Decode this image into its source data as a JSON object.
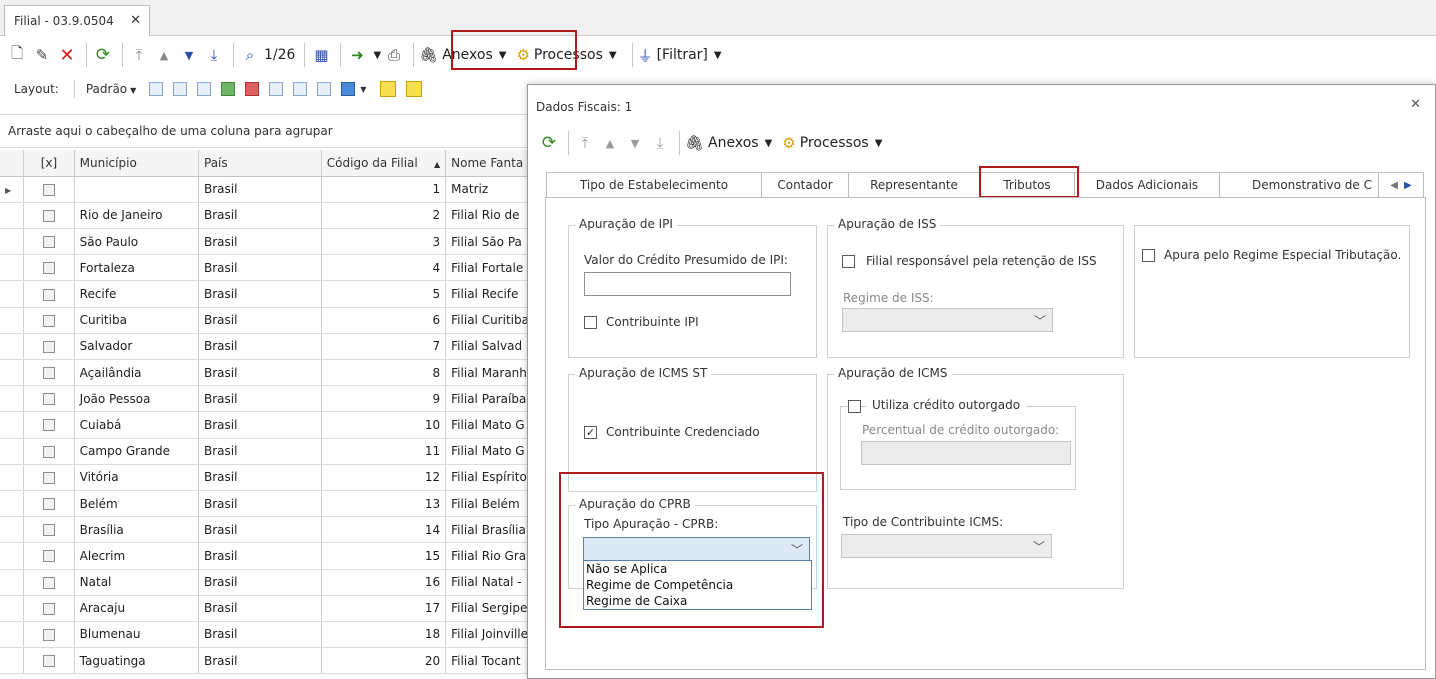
{
  "tab": {
    "title": "Filial - 03.9.0504",
    "close": "✕"
  },
  "toolbar": {
    "counter": "1/26",
    "anexos": "Anexos",
    "processos": "Processos",
    "filtrar": "[Filtrar]"
  },
  "layoutbar": {
    "label": "Layout:",
    "padrao": "Padrão"
  },
  "grouphint": "Arraste aqui o cabeçalho de uma coluna para agrupar",
  "grid": {
    "headers": {
      "sel": "[x]",
      "municipio": "Município",
      "pais": "País",
      "codigo": "Código da Filial",
      "nome": "Nome Fanta"
    },
    "rows": [
      {
        "municipio": "",
        "pais": "Brasil",
        "codigo": "1",
        "nome": "Matriz"
      },
      {
        "municipio": "Rio de Janeiro",
        "pais": "Brasil",
        "codigo": "2",
        "nome": "Filial Rio de"
      },
      {
        "municipio": "São Paulo",
        "pais": "Brasil",
        "codigo": "3",
        "nome": "Filial São Pa"
      },
      {
        "municipio": "Fortaleza",
        "pais": "Brasil",
        "codigo": "4",
        "nome": "Filial Fortale"
      },
      {
        "municipio": "Recife",
        "pais": "Brasil",
        "codigo": "5",
        "nome": "Filial Recife"
      },
      {
        "municipio": "Curitiba",
        "pais": "Brasil",
        "codigo": "6",
        "nome": "Filial Curitiba"
      },
      {
        "municipio": "Salvador",
        "pais": "Brasil",
        "codigo": "7",
        "nome": "Filial Salvad"
      },
      {
        "municipio": "Açailândia",
        "pais": "Brasil",
        "codigo": "8",
        "nome": "Filial Maranh"
      },
      {
        "municipio": "João Pessoa",
        "pais": "Brasil",
        "codigo": "9",
        "nome": "Filial Paraíba"
      },
      {
        "municipio": "Cuiabá",
        "pais": "Brasil",
        "codigo": "10",
        "nome": "Filial Mato G"
      },
      {
        "municipio": "Campo Grande",
        "pais": "Brasil",
        "codigo": "11",
        "nome": "Filial Mato G"
      },
      {
        "municipio": "Vitória",
        "pais": "Brasil",
        "codigo": "12",
        "nome": "Filial Espírito"
      },
      {
        "municipio": "Belém",
        "pais": "Brasil",
        "codigo": "13",
        "nome": "Filial Belém"
      },
      {
        "municipio": "Brasília",
        "pais": "Brasil",
        "codigo": "14",
        "nome": "Filial Brasília"
      },
      {
        "municipio": "Alecrim",
        "pais": "Brasil",
        "codigo": "15",
        "nome": "Filial Rio Gra"
      },
      {
        "municipio": "Natal",
        "pais": "Brasil",
        "codigo": "16",
        "nome": "Filial  Natal -"
      },
      {
        "municipio": "Aracaju",
        "pais": "Brasil",
        "codigo": "17",
        "nome": "Filial Sergipe"
      },
      {
        "municipio": "Blumenau",
        "pais": "Brasil",
        "codigo": "18",
        "nome": "Filial Joinville"
      },
      {
        "municipio": "Taguatinga",
        "pais": "Brasil",
        "codigo": "20",
        "nome": "Filial Tocant"
      }
    ]
  },
  "dialog": {
    "title": "Dados Fiscais: 1",
    "close": "✕",
    "anexos": "Anexos",
    "processos": "Processos",
    "tabs": [
      "Tipo de Estabelecimento",
      "Contador",
      "Representante",
      "Tributos",
      "Dados Adicionais",
      "Demonstrativo de C"
    ],
    "ipi": {
      "title": "Apuração de IPI",
      "valor_label": "Valor do Crédito Presumido de IPI:",
      "valor": "",
      "contribuinte": "Contribuinte IPI"
    },
    "iss": {
      "title": "Apuração de ISS",
      "responsavel": "Filial responsável pela retenção de ISS",
      "regime_label": "Regime de ISS:",
      "regime": ""
    },
    "especial": {
      "label": "Apura pelo Regime Especial Tributação."
    },
    "icmsst": {
      "title": "Apuração de ICMS ST",
      "credenciado": "Contribuinte Credenciado"
    },
    "icms": {
      "title": "Apuração de ICMS",
      "utiliza": "Utiliza crédito outorgado",
      "percentual_label": "Percentual de crédito outorgado:",
      "percentual": "",
      "tipo_label": "Tipo de Contribuinte ICMS:",
      "tipo": ""
    },
    "cprb": {
      "title": "Apuração do CPRB",
      "tipo_label": "Tipo Apuração - CPRB:",
      "tipo": "",
      "options": [
        "Não se Aplica",
        "Regime de Competência",
        "Regime de Caixa"
      ]
    }
  }
}
